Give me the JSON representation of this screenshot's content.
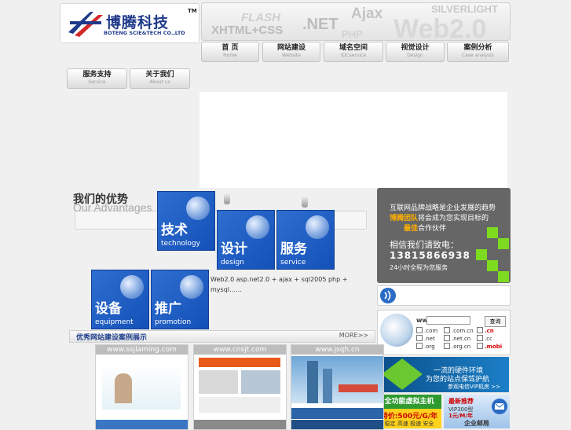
{
  "logo": {
    "name_cn": "博腾科技",
    "name_en": "BOTENG SCIE&TECH CO.,LTD",
    "tm": "TM"
  },
  "banner": {
    "words": [
      "FLASH",
      "XHTML+CSS",
      ".NET",
      "Ajax",
      "PHP",
      "SILVERLIGHT",
      "Web2.0"
    ]
  },
  "nav": [
    {
      "label": "首 页",
      "sub": "Home"
    },
    {
      "label": "网站建设",
      "sub": "Website"
    },
    {
      "label": "域名空间",
      "sub": "IDCservice"
    },
    {
      "label": "视觉设计",
      "sub": "Design"
    },
    {
      "label": "案例分析",
      "sub": "Case analysis"
    },
    {
      "label": "服务支持",
      "sub": "Service"
    },
    {
      "label": "关于我们",
      "sub": "About us"
    }
  ],
  "advantages": {
    "title": "我们的优势",
    "subtitle": "Our Advantages",
    "tiles": [
      {
        "cn": "技术",
        "en": "technology"
      },
      {
        "cn": "设计",
        "en": "design"
      },
      {
        "cn": "服务",
        "en": "service"
      },
      {
        "cn": "设备",
        "en": "equipment"
      },
      {
        "cn": "推广",
        "en": "promotion"
      }
    ],
    "tech_text": "Web2.0      asp.net2.0 + ajax + sql2005 php + mysql……"
  },
  "promo": {
    "line1": "互联网品牌战略是企业发展的趋势",
    "line2a": "博腾团队",
    "line2b": "将会成为您实现目标的",
    "line3a": "最佳",
    "line3b": "合作伙伴",
    "line4": "相信我们请致电：",
    "phone": "13815866938",
    "line5": "24小时全程为您服务"
  },
  "domain": {
    "label": "www.",
    "button": "查询",
    "options": [
      ".com",
      ".com.cn",
      ".cn",
      ".net",
      ".net.cn",
      ".cc",
      ".org",
      ".org.cn",
      ".mobi"
    ]
  },
  "ads": {
    "hw1": "一流的硬件环境",
    "hw2": "为您的站点保驾护航",
    "hw3": "参观电信VIP机房 >>",
    "vh1": "全功能虚拟主机",
    "vh2": "特价:500元/G/年",
    "vh3": "稳定 高速 极速 安全",
    "rec1": "最新推荐",
    "rec2": "VIP300型",
    "rec3": "1元/M/年",
    "news": "企业邮局"
  },
  "cases": {
    "title": "优秀网站建设案例展示",
    "more": "MORE>>",
    "items": [
      {
        "url": "www.ssjlaming.com"
      },
      {
        "url": "www.cnsjt.com"
      },
      {
        "url": "www.jsqh.cn"
      }
    ]
  }
}
